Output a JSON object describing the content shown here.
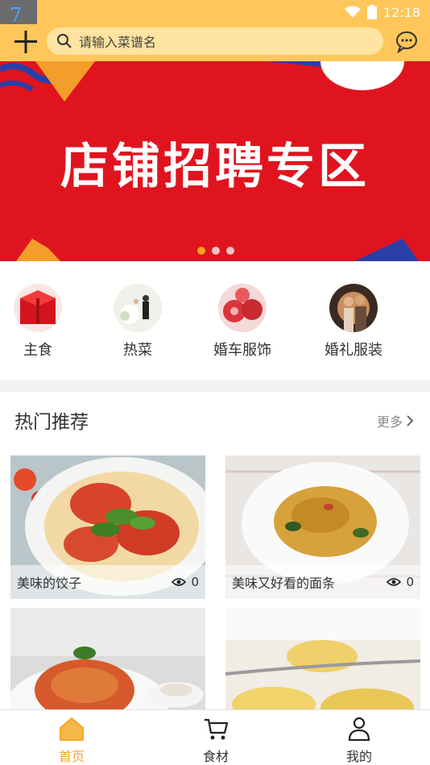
{
  "status": {
    "badge": "7",
    "time": "12:18"
  },
  "header": {
    "search_placeholder": "请输入菜谱名"
  },
  "banner": {
    "title": "店铺招聘专区",
    "slides": 3,
    "active_slide": 1
  },
  "categories": [
    {
      "label": "主食",
      "icon": "red-gift-box"
    },
    {
      "label": "热菜",
      "icon": "bride-groom"
    },
    {
      "label": "婚车服饰",
      "icon": "wedding-balloons"
    },
    {
      "label": "婚礼服装",
      "icon": "wedding-couple"
    }
  ],
  "hot": {
    "title": "热门推荐",
    "more": "更多",
    "items": [
      {
        "name": "美味的饺子",
        "views": "0"
      },
      {
        "name": "美味又好看的面条",
        "views": "0"
      },
      {
        "name": "",
        "views": ""
      },
      {
        "name": "",
        "views": ""
      }
    ]
  },
  "tabs": [
    {
      "label": "首页",
      "icon": "home-icon",
      "active": true
    },
    {
      "label": "食材",
      "icon": "cart-icon",
      "active": false
    },
    {
      "label": "我的",
      "icon": "user-icon",
      "active": false
    }
  ],
  "colors": {
    "accent": "#ffc659",
    "active_tab": "#f5a623",
    "banner_red": "#e0141e"
  }
}
